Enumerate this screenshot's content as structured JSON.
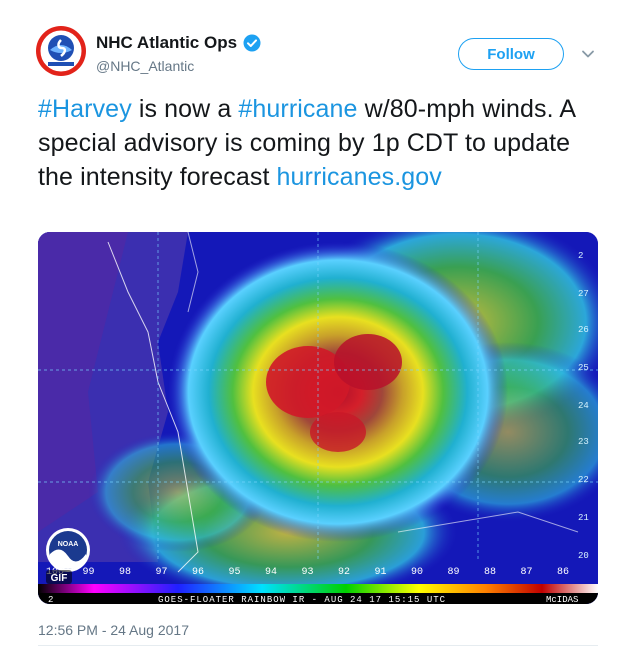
{
  "account": {
    "display_name": "NHC Atlantic Ops",
    "handle": "@NHC_Atlantic",
    "verified": true,
    "avatar_icon": "nhc-seal-icon"
  },
  "actions": {
    "follow_label": "Follow",
    "more_icon": "chevron-down-icon"
  },
  "tweet": {
    "parts": [
      {
        "type": "hashtag",
        "text": "#Harvey"
      },
      {
        "type": "text",
        "text": " is now a "
      },
      {
        "type": "hashtag",
        "text": "#hurricane"
      },
      {
        "type": "text",
        "text": " w/80-mph winds.  A special advisory is coming by 1p CDT to update the intensity forecast "
      },
      {
        "type": "link",
        "text": "hurricanes.gov"
      }
    ]
  },
  "media": {
    "caption": "GOES-FLOATER RAINBOW IR - AUG 24 17 15:15 UTC",
    "credit": "McIDAS",
    "logo_text": "NOAA",
    "gif_badge": "GIF",
    "scale_start": "2",
    "longitudes": [
      "100",
      "99",
      "98",
      "97",
      "96",
      "95",
      "94",
      "93",
      "92",
      "91",
      "90",
      "89",
      "88",
      "87",
      "86"
    ],
    "latitudes": [
      "2",
      "27",
      "26",
      "25",
      "24",
      "23",
      "22",
      "21",
      "20"
    ]
  },
  "meta": {
    "timestamp": "12:56 PM - 24 Aug 2017"
  },
  "colors": {
    "accent": "#1da1f2",
    "link": "#1b95e0",
    "secondary_text": "#657786"
  }
}
